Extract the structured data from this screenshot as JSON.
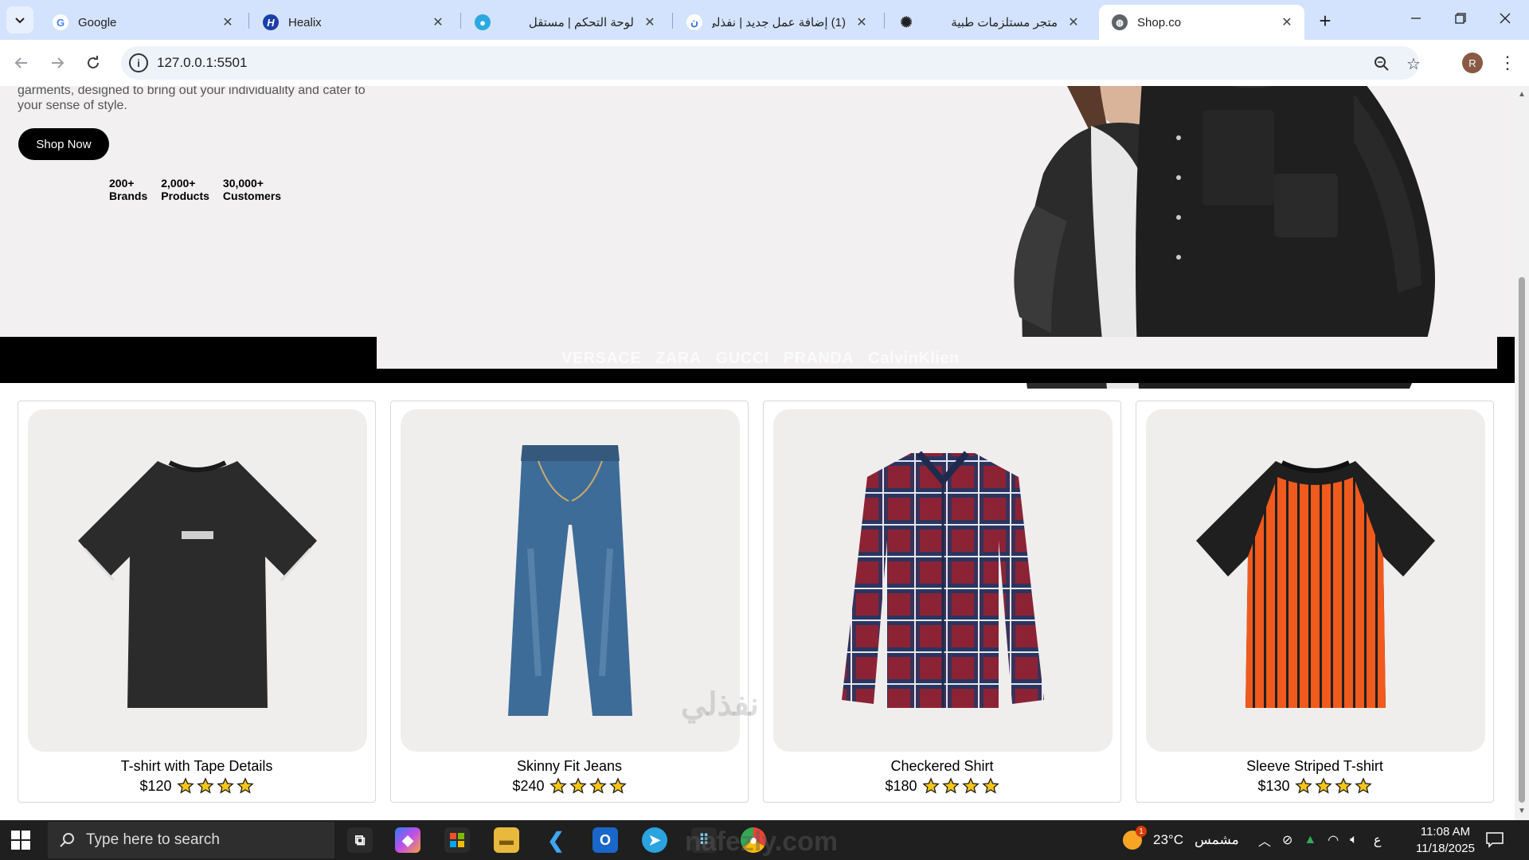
{
  "browser": {
    "tabs": [
      {
        "title": "Google",
        "favicon": "google-icon",
        "rtl": false
      },
      {
        "title": "Healix",
        "favicon": "healix-icon",
        "rtl": false
      },
      {
        "title": "لوحة التحكم | مستقل",
        "favicon": "mostaql-icon",
        "rtl": true
      },
      {
        "title": "(1) إضافة عمل جديد | نفذلي",
        "favicon": "nafezly-icon",
        "rtl": true
      },
      {
        "title": "متجر مستلزمات طبية",
        "favicon": "openai-icon",
        "rtl": true
      },
      {
        "title": "Shop.co",
        "favicon": "globe-icon",
        "rtl": false,
        "active": true
      }
    ],
    "url": "127.0.0.1:5501",
    "profile_initial": "R"
  },
  "hero": {
    "description": "garments, designed to bring out your individuality and cater to your sense of style.",
    "cta_label": "Shop Now",
    "stats": [
      {
        "value": "200+",
        "label": "Brands"
      },
      {
        "value": "2,000+",
        "label": "Products"
      },
      {
        "value": "30,000+",
        "label": "Customers"
      }
    ],
    "brands": [
      "VERSACE",
      "ZARA",
      "GUCCI",
      "PRANDA",
      "CalvinKlien"
    ]
  },
  "products": [
    {
      "name": "T-shirt with Tape Details",
      "price": "$120",
      "rating": 4,
      "image": "black-tshirt"
    },
    {
      "name": "Skinny Fit Jeans",
      "price": "$240",
      "rating": 4,
      "image": "blue-jeans"
    },
    {
      "name": "Checkered Shirt",
      "price": "$180",
      "rating": 4,
      "image": "plaid-shirt"
    },
    {
      "name": "Sleeve Striped T-shirt",
      "price": "$130",
      "rating": 4,
      "image": "striped-tshirt"
    }
  ],
  "watermark": "nafezly.com",
  "watermark_arabic": "نفذلي",
  "taskbar": {
    "search_placeholder": "Type here to search",
    "weather_temp": "23°C",
    "weather_text": "مشمس",
    "weather_badge": "1",
    "input_lang": "ع",
    "time": "11:08 AM",
    "date": "11/18/2025"
  },
  "colors": {
    "tabbar_bg": "#d3e3fd",
    "hero_bg": "#f2f0f1",
    "star": "#f5c518",
    "taskbar_bg": "#1f1f1f"
  }
}
